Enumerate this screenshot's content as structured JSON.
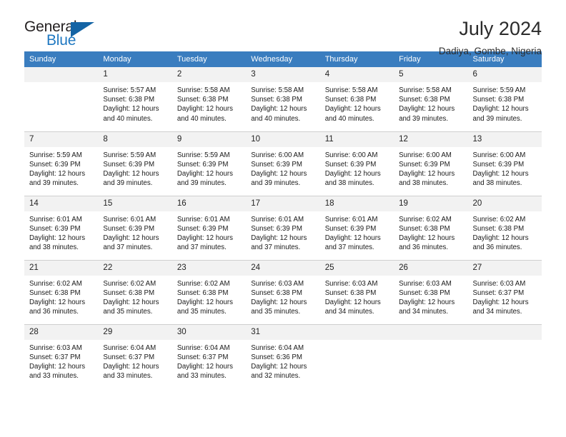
{
  "brand": {
    "name_part1": "General",
    "name_part2": "Blue",
    "accent_color": "#1f78c1",
    "triangle_color": "#1464a5"
  },
  "header": {
    "month_title": "July 2024",
    "location": "Dadiya, Gombe, Nigeria"
  },
  "calendar": {
    "header_bg": "#3a7dbf",
    "daynum_bg": "#f2f2f2",
    "weekday_headers": [
      "Sunday",
      "Monday",
      "Tuesday",
      "Wednesday",
      "Thursday",
      "Friday",
      "Saturday"
    ],
    "weeks": [
      [
        {
          "day": "",
          "empty": true,
          "sunrise": "",
          "sunset": "",
          "daylight_line1": "",
          "daylight_line2": ""
        },
        {
          "day": "1",
          "empty": false,
          "sunrise": "Sunrise: 5:57 AM",
          "sunset": "Sunset: 6:38 PM",
          "daylight_line1": "Daylight: 12 hours",
          "daylight_line2": "and 40 minutes."
        },
        {
          "day": "2",
          "empty": false,
          "sunrise": "Sunrise: 5:58 AM",
          "sunset": "Sunset: 6:38 PM",
          "daylight_line1": "Daylight: 12 hours",
          "daylight_line2": "and 40 minutes."
        },
        {
          "day": "3",
          "empty": false,
          "sunrise": "Sunrise: 5:58 AM",
          "sunset": "Sunset: 6:38 PM",
          "daylight_line1": "Daylight: 12 hours",
          "daylight_line2": "and 40 minutes."
        },
        {
          "day": "4",
          "empty": false,
          "sunrise": "Sunrise: 5:58 AM",
          "sunset": "Sunset: 6:38 PM",
          "daylight_line1": "Daylight: 12 hours",
          "daylight_line2": "and 40 minutes."
        },
        {
          "day": "5",
          "empty": false,
          "sunrise": "Sunrise: 5:58 AM",
          "sunset": "Sunset: 6:38 PM",
          "daylight_line1": "Daylight: 12 hours",
          "daylight_line2": "and 39 minutes."
        },
        {
          "day": "6",
          "empty": false,
          "sunrise": "Sunrise: 5:59 AM",
          "sunset": "Sunset: 6:38 PM",
          "daylight_line1": "Daylight: 12 hours",
          "daylight_line2": "and 39 minutes."
        }
      ],
      [
        {
          "day": "7",
          "empty": false,
          "sunrise": "Sunrise: 5:59 AM",
          "sunset": "Sunset: 6:39 PM",
          "daylight_line1": "Daylight: 12 hours",
          "daylight_line2": "and 39 minutes."
        },
        {
          "day": "8",
          "empty": false,
          "sunrise": "Sunrise: 5:59 AM",
          "sunset": "Sunset: 6:39 PM",
          "daylight_line1": "Daylight: 12 hours",
          "daylight_line2": "and 39 minutes."
        },
        {
          "day": "9",
          "empty": false,
          "sunrise": "Sunrise: 5:59 AM",
          "sunset": "Sunset: 6:39 PM",
          "daylight_line1": "Daylight: 12 hours",
          "daylight_line2": "and 39 minutes."
        },
        {
          "day": "10",
          "empty": false,
          "sunrise": "Sunrise: 6:00 AM",
          "sunset": "Sunset: 6:39 PM",
          "daylight_line1": "Daylight: 12 hours",
          "daylight_line2": "and 39 minutes."
        },
        {
          "day": "11",
          "empty": false,
          "sunrise": "Sunrise: 6:00 AM",
          "sunset": "Sunset: 6:39 PM",
          "daylight_line1": "Daylight: 12 hours",
          "daylight_line2": "and 38 minutes."
        },
        {
          "day": "12",
          "empty": false,
          "sunrise": "Sunrise: 6:00 AM",
          "sunset": "Sunset: 6:39 PM",
          "daylight_line1": "Daylight: 12 hours",
          "daylight_line2": "and 38 minutes."
        },
        {
          "day": "13",
          "empty": false,
          "sunrise": "Sunrise: 6:00 AM",
          "sunset": "Sunset: 6:39 PM",
          "daylight_line1": "Daylight: 12 hours",
          "daylight_line2": "and 38 minutes."
        }
      ],
      [
        {
          "day": "14",
          "empty": false,
          "sunrise": "Sunrise: 6:01 AM",
          "sunset": "Sunset: 6:39 PM",
          "daylight_line1": "Daylight: 12 hours",
          "daylight_line2": "and 38 minutes."
        },
        {
          "day": "15",
          "empty": false,
          "sunrise": "Sunrise: 6:01 AM",
          "sunset": "Sunset: 6:39 PM",
          "daylight_line1": "Daylight: 12 hours",
          "daylight_line2": "and 37 minutes."
        },
        {
          "day": "16",
          "empty": false,
          "sunrise": "Sunrise: 6:01 AM",
          "sunset": "Sunset: 6:39 PM",
          "daylight_line1": "Daylight: 12 hours",
          "daylight_line2": "and 37 minutes."
        },
        {
          "day": "17",
          "empty": false,
          "sunrise": "Sunrise: 6:01 AM",
          "sunset": "Sunset: 6:39 PM",
          "daylight_line1": "Daylight: 12 hours",
          "daylight_line2": "and 37 minutes."
        },
        {
          "day": "18",
          "empty": false,
          "sunrise": "Sunrise: 6:01 AM",
          "sunset": "Sunset: 6:39 PM",
          "daylight_line1": "Daylight: 12 hours",
          "daylight_line2": "and 37 minutes."
        },
        {
          "day": "19",
          "empty": false,
          "sunrise": "Sunrise: 6:02 AM",
          "sunset": "Sunset: 6:38 PM",
          "daylight_line1": "Daylight: 12 hours",
          "daylight_line2": "and 36 minutes."
        },
        {
          "day": "20",
          "empty": false,
          "sunrise": "Sunrise: 6:02 AM",
          "sunset": "Sunset: 6:38 PM",
          "daylight_line1": "Daylight: 12 hours",
          "daylight_line2": "and 36 minutes."
        }
      ],
      [
        {
          "day": "21",
          "empty": false,
          "sunrise": "Sunrise: 6:02 AM",
          "sunset": "Sunset: 6:38 PM",
          "daylight_line1": "Daylight: 12 hours",
          "daylight_line2": "and 36 minutes."
        },
        {
          "day": "22",
          "empty": false,
          "sunrise": "Sunrise: 6:02 AM",
          "sunset": "Sunset: 6:38 PM",
          "daylight_line1": "Daylight: 12 hours",
          "daylight_line2": "and 35 minutes."
        },
        {
          "day": "23",
          "empty": false,
          "sunrise": "Sunrise: 6:02 AM",
          "sunset": "Sunset: 6:38 PM",
          "daylight_line1": "Daylight: 12 hours",
          "daylight_line2": "and 35 minutes."
        },
        {
          "day": "24",
          "empty": false,
          "sunrise": "Sunrise: 6:03 AM",
          "sunset": "Sunset: 6:38 PM",
          "daylight_line1": "Daylight: 12 hours",
          "daylight_line2": "and 35 minutes."
        },
        {
          "day": "25",
          "empty": false,
          "sunrise": "Sunrise: 6:03 AM",
          "sunset": "Sunset: 6:38 PM",
          "daylight_line1": "Daylight: 12 hours",
          "daylight_line2": "and 34 minutes."
        },
        {
          "day": "26",
          "empty": false,
          "sunrise": "Sunrise: 6:03 AM",
          "sunset": "Sunset: 6:38 PM",
          "daylight_line1": "Daylight: 12 hours",
          "daylight_line2": "and 34 minutes."
        },
        {
          "day": "27",
          "empty": false,
          "sunrise": "Sunrise: 6:03 AM",
          "sunset": "Sunset: 6:37 PM",
          "daylight_line1": "Daylight: 12 hours",
          "daylight_line2": "and 34 minutes."
        }
      ],
      [
        {
          "day": "28",
          "empty": false,
          "sunrise": "Sunrise: 6:03 AM",
          "sunset": "Sunset: 6:37 PM",
          "daylight_line1": "Daylight: 12 hours",
          "daylight_line2": "and 33 minutes."
        },
        {
          "day": "29",
          "empty": false,
          "sunrise": "Sunrise: 6:04 AM",
          "sunset": "Sunset: 6:37 PM",
          "daylight_line1": "Daylight: 12 hours",
          "daylight_line2": "and 33 minutes."
        },
        {
          "day": "30",
          "empty": false,
          "sunrise": "Sunrise: 6:04 AM",
          "sunset": "Sunset: 6:37 PM",
          "daylight_line1": "Daylight: 12 hours",
          "daylight_line2": "and 33 minutes."
        },
        {
          "day": "31",
          "empty": false,
          "sunrise": "Sunrise: 6:04 AM",
          "sunset": "Sunset: 6:36 PM",
          "daylight_line1": "Daylight: 12 hours",
          "daylight_line2": "and 32 minutes."
        },
        {
          "day": "",
          "empty": true,
          "sunrise": "",
          "sunset": "",
          "daylight_line1": "",
          "daylight_line2": ""
        },
        {
          "day": "",
          "empty": true,
          "sunrise": "",
          "sunset": "",
          "daylight_line1": "",
          "daylight_line2": ""
        },
        {
          "day": "",
          "empty": true,
          "sunrise": "",
          "sunset": "",
          "daylight_line1": "",
          "daylight_line2": ""
        }
      ]
    ]
  }
}
